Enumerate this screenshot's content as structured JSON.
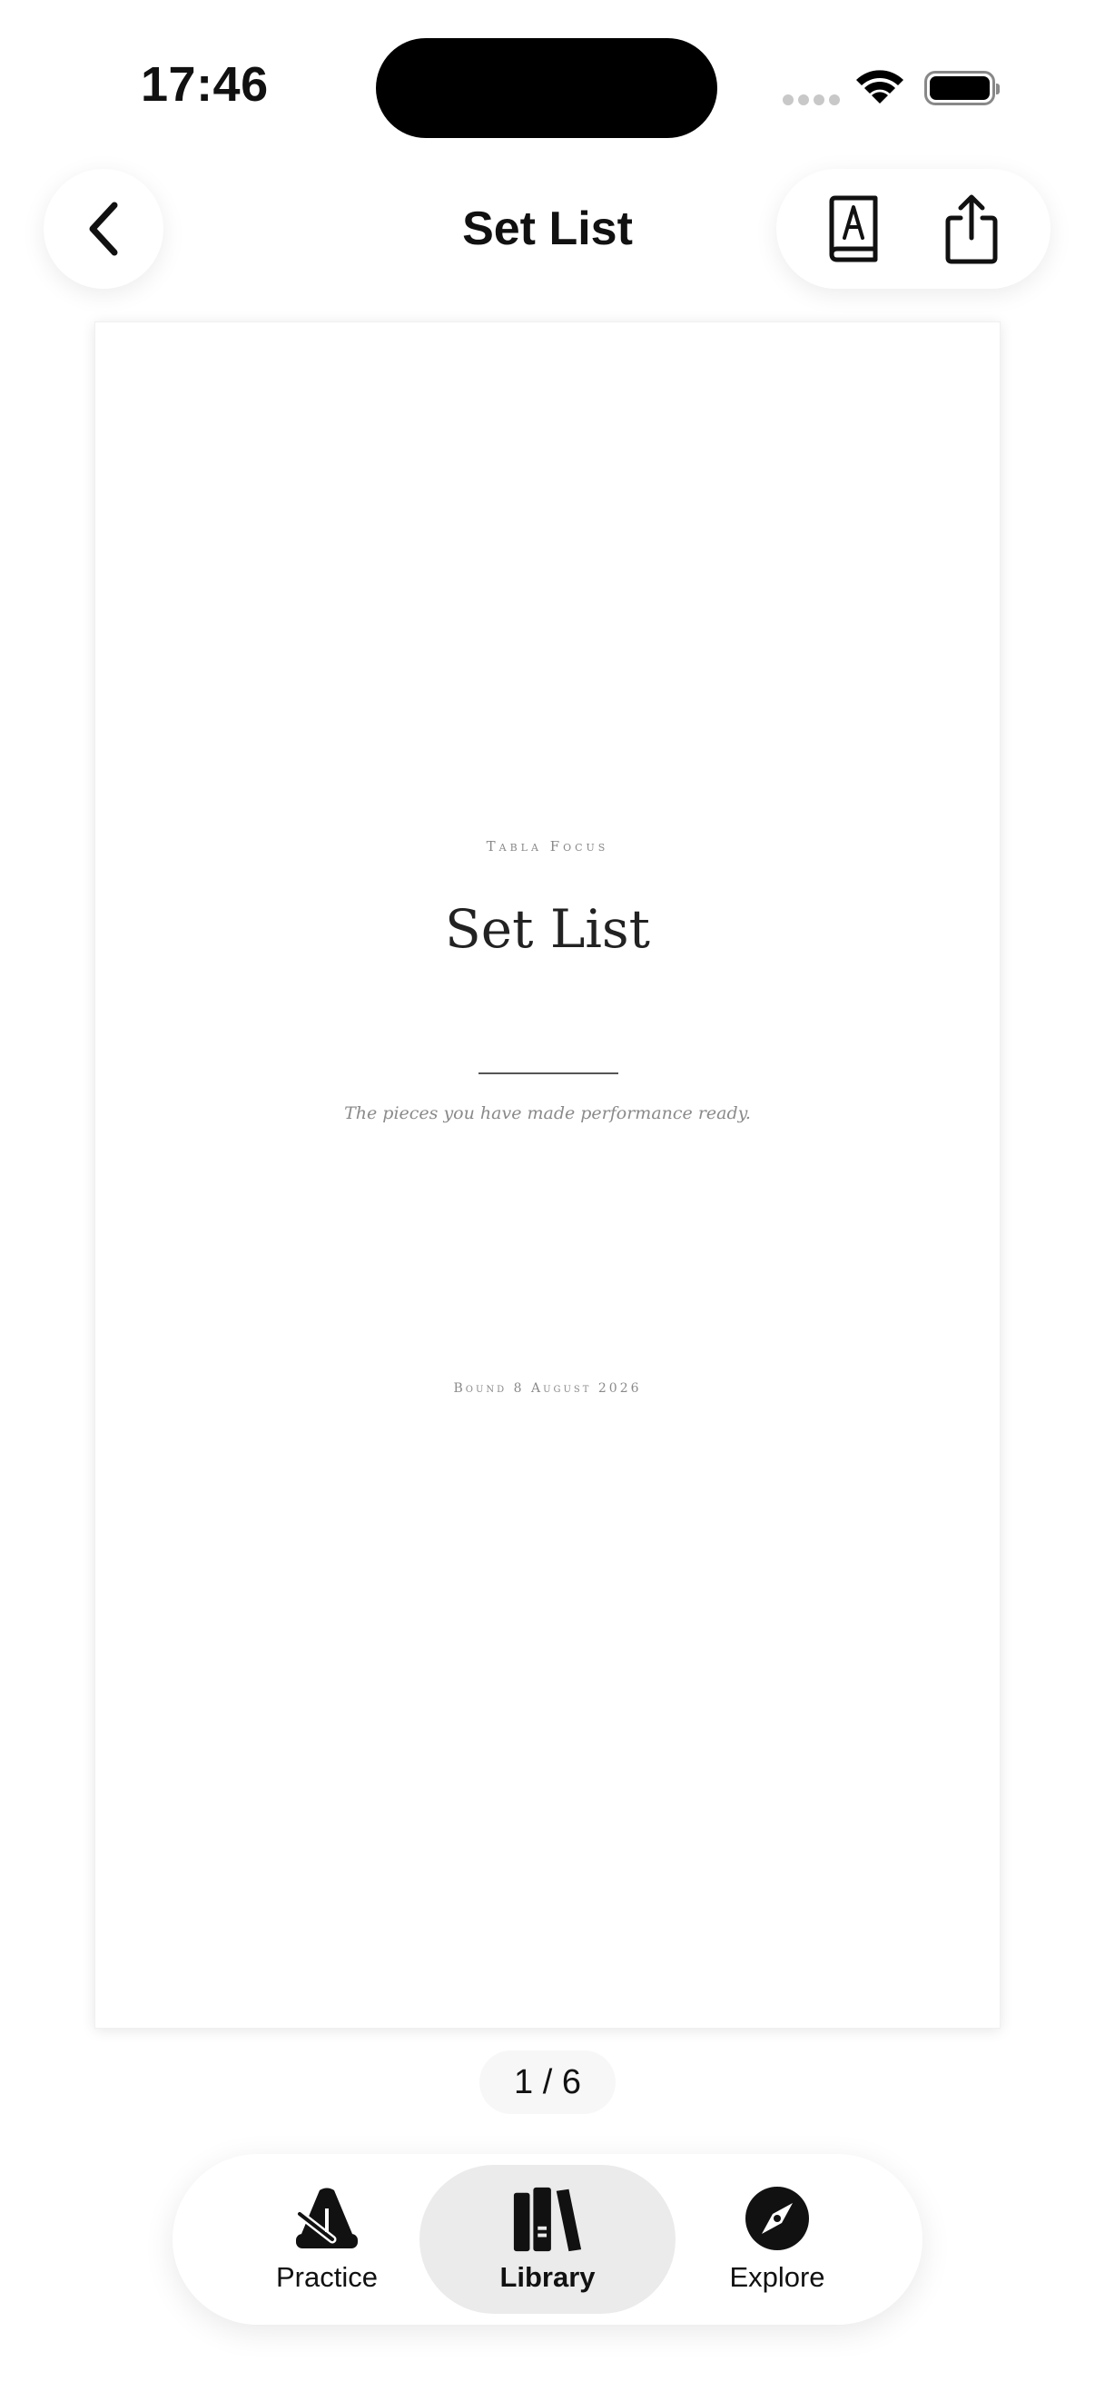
{
  "status_bar": {
    "time": "17:46"
  },
  "nav": {
    "title": "Set List"
  },
  "document": {
    "eyebrow": "Tabla Focus",
    "title": "Set List",
    "subtitle": "The pieces you have made performance ready.",
    "bound": "Bound 8 August 2026"
  },
  "pager": {
    "indicator": "1 / 6"
  },
  "tabs": [
    {
      "label": "Practice",
      "icon": "metronome-icon",
      "selected": false
    },
    {
      "label": "Library",
      "icon": "books-icon",
      "selected": true
    },
    {
      "label": "Explore",
      "icon": "compass-icon",
      "selected": false
    }
  ],
  "icons": {
    "back": "chevron-left-icon",
    "dictionary": "book-letter-icon",
    "share": "share-icon"
  }
}
